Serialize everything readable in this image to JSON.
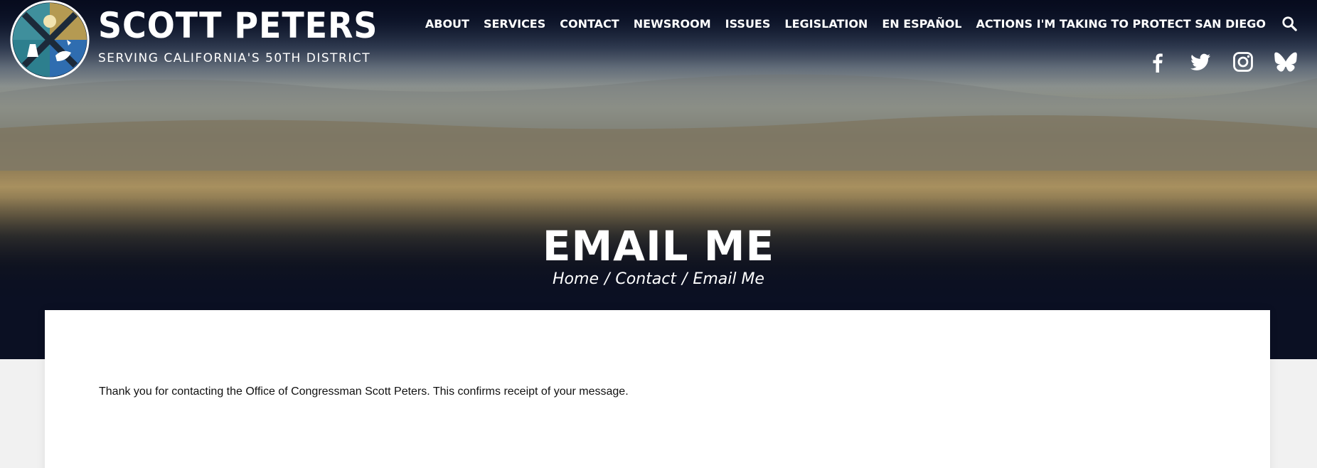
{
  "brand": {
    "name": "SCOTT PETERS",
    "subtitle": "SERVING CALIFORNIA'S 50TH DISTRICT"
  },
  "nav": {
    "items": [
      {
        "label": "ABOUT"
      },
      {
        "label": "SERVICES"
      },
      {
        "label": "CONTACT"
      },
      {
        "label": "NEWSROOM"
      },
      {
        "label": "ISSUES"
      },
      {
        "label": "LEGISLATION"
      },
      {
        "label": "EN ESPAÑOL"
      },
      {
        "label": "ACTIONS I'M TAKING TO PROTECT SAN DIEGO"
      }
    ],
    "search_icon": "search-icon"
  },
  "social": [
    "facebook-icon",
    "twitter-icon",
    "instagram-icon",
    "bluesky-icon"
  ],
  "hero": {
    "title": "EMAIL ME",
    "breadcrumb": [
      "Home",
      "Contact",
      "Email Me"
    ],
    "breadcrumb_separator": "/"
  },
  "content": {
    "message": "Thank you for contacting the Office of Congressman Scott Peters. This confirms receipt of your message."
  },
  "colors": {
    "navy": "#0b1023",
    "seal_gold": "#b59a52",
    "seal_teal": "#3f8f9c",
    "seal_blue": "#2f6db0",
    "page_bg": "#f1f1f1"
  }
}
